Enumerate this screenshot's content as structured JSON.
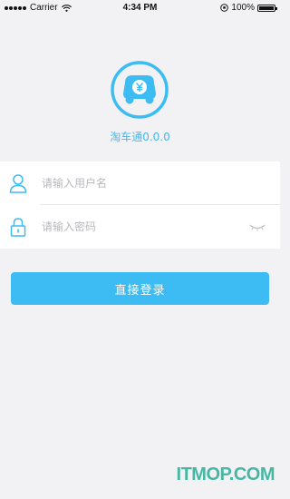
{
  "status_bar": {
    "carrier": "Carrier",
    "time": "4:34 PM",
    "battery_percent": "100%",
    "battery_level": 1.0
  },
  "app": {
    "name": "淘车通0.0.0",
    "logo_icon": "yuan-car-icon",
    "accent_color": "#3cbcf3"
  },
  "form": {
    "username_placeholder": "请输入用户名",
    "password_placeholder": "请输入密码"
  },
  "login_button": {
    "label": "直接登录"
  },
  "watermark": {
    "text": "ITMOP.COM"
  }
}
